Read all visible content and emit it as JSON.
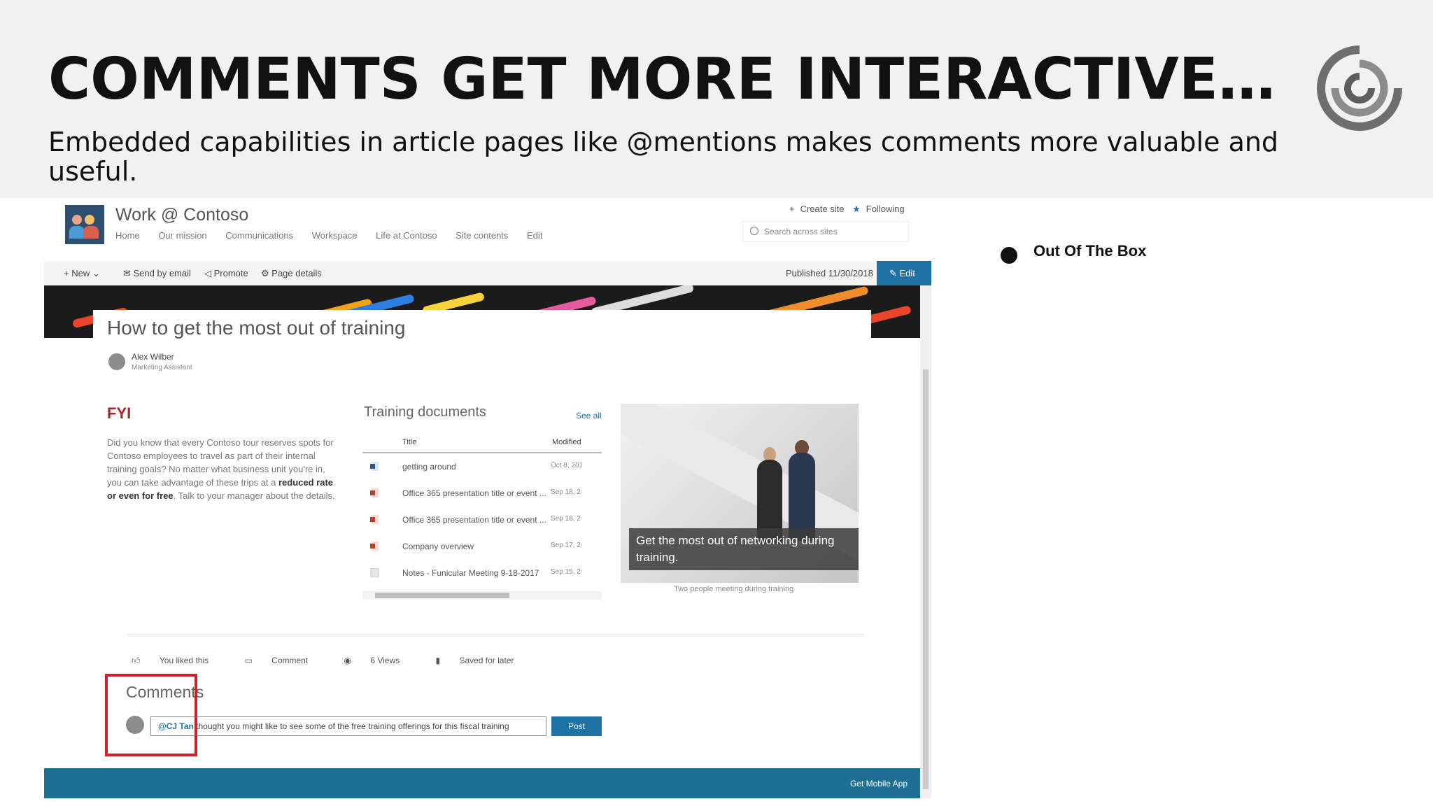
{
  "slide": {
    "title": "COMMENTS GET MORE INTERACTIVE…",
    "subtitle": "Embedded capabilities in article pages like @mentions makes comments more valuable and useful.",
    "bullet": "Out Of The Box",
    "logo_icon": "swirl-logo-icon"
  },
  "site": {
    "name": "Work @ Contoso",
    "nav": [
      "Home",
      "Our mission",
      "Communications",
      "Workspace",
      "Life at Contoso",
      "Site contents",
      "Edit"
    ],
    "create_site": "Create site",
    "following": "Following",
    "search_placeholder": "Search across sites"
  },
  "cmdbar": {
    "new": "New",
    "send_email": "Send by email",
    "promote": "Promote",
    "page_details": "Page details",
    "published": "Published 11/30/2018",
    "edit": "Edit"
  },
  "article": {
    "title": "How to get the most out of training",
    "author": "Alex Wilber",
    "role": "Marketing Assistant",
    "fyi_heading": "FYI",
    "fyi_text_1": "Did you know that every Contoso tour reserves spots for Contoso employees to travel as part of their internal training goals? No matter what business unit you're in, you can take advantage of these trips at a ",
    "fyi_bold": "reduced rate or even for free",
    "fyi_text_2": ". Talk to your manager about the details."
  },
  "training_docs": {
    "title": "Training documents",
    "see_all": "See all",
    "col_title": "Title",
    "col_modified": "Modified",
    "rows": [
      {
        "name": "getting around",
        "modified": "Oct 8, 201",
        "icon": "word-doc-icon"
      },
      {
        "name": "Office 365 presentation title or event ...",
        "modified": "Sep 18, 2C",
        "icon": "powerpoint-doc-icon"
      },
      {
        "name": "Office 365 presentation title or event ...",
        "modified": "Sep 18, 2C",
        "icon": "powerpoint-doc-icon"
      },
      {
        "name": "Company overview",
        "modified": "Sep 17, 2C",
        "icon": "powerpoint-doc-icon"
      },
      {
        "name": "Notes - Funicular Meeting 9-18-2017",
        "modified": "Sep 15, 2C",
        "icon": "generic-doc-icon"
      }
    ]
  },
  "hero_image": {
    "caption": "Get the most out of networking during training.",
    "alt_caption": "Two people meeting during training"
  },
  "social": {
    "liked": "You liked this",
    "comment": "Comment",
    "views": "6 Views",
    "saved": "Saved for later"
  },
  "comments": {
    "title": "Comments",
    "mention": "@CJ Tan",
    "input_text": " thought you might like to see some of the free training offerings for this fiscal training",
    "post": "Post"
  },
  "footer": {
    "mobile_app": "Get Mobile App"
  },
  "colors": {
    "accent": "#1e72a4",
    "highlight_box": "#d0202a",
    "fyi": "#a4262c",
    "footer": "#1e6f93"
  }
}
